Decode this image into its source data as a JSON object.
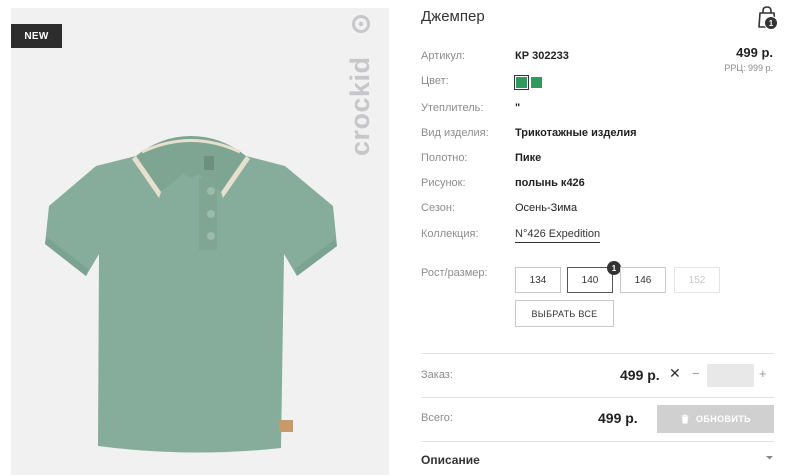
{
  "product": {
    "badge": "NEW",
    "brand": "crockid",
    "title": "Джемпер",
    "price": "499 р.",
    "rrp": "РРЦ: 999 р."
  },
  "cart": {
    "count": "1",
    "icon": "shopping-bag-icon"
  },
  "specs": [
    {
      "label": "Артикул:",
      "value": "КР 302233"
    },
    {
      "label": "Цвет:",
      "value": ""
    },
    {
      "label": "Утеплитель:",
      "value": "\""
    },
    {
      "label": "Вид изделия:",
      "value": "Трикотажные изделия"
    },
    {
      "label": "Полотно:",
      "value": "Пике"
    },
    {
      "label": "Рисунок:",
      "value": "полынь к426"
    },
    {
      "label": "Сезон:",
      "value": "Осень-Зима"
    },
    {
      "label": "Коллекция:",
      "value": "N°426 Expedition"
    }
  ],
  "colors": {
    "swatch_color": "#2e9a5b"
  },
  "sizes": {
    "label": "Рост/размер:",
    "options": [
      "134",
      "140",
      "146",
      "152"
    ],
    "selected": "140",
    "selected_qty": "1",
    "select_all": "ВЫБРАТЬ ВСЕ"
  },
  "order": {
    "label": "Заказ:",
    "price": "499 р.",
    "times": "✕",
    "minus": "−",
    "plus": "+",
    "qty_value": ""
  },
  "total": {
    "label": "Всего:",
    "price": "499 р.",
    "update_button": "ОБНОВИТЬ"
  },
  "description": {
    "label": "Описание"
  }
}
